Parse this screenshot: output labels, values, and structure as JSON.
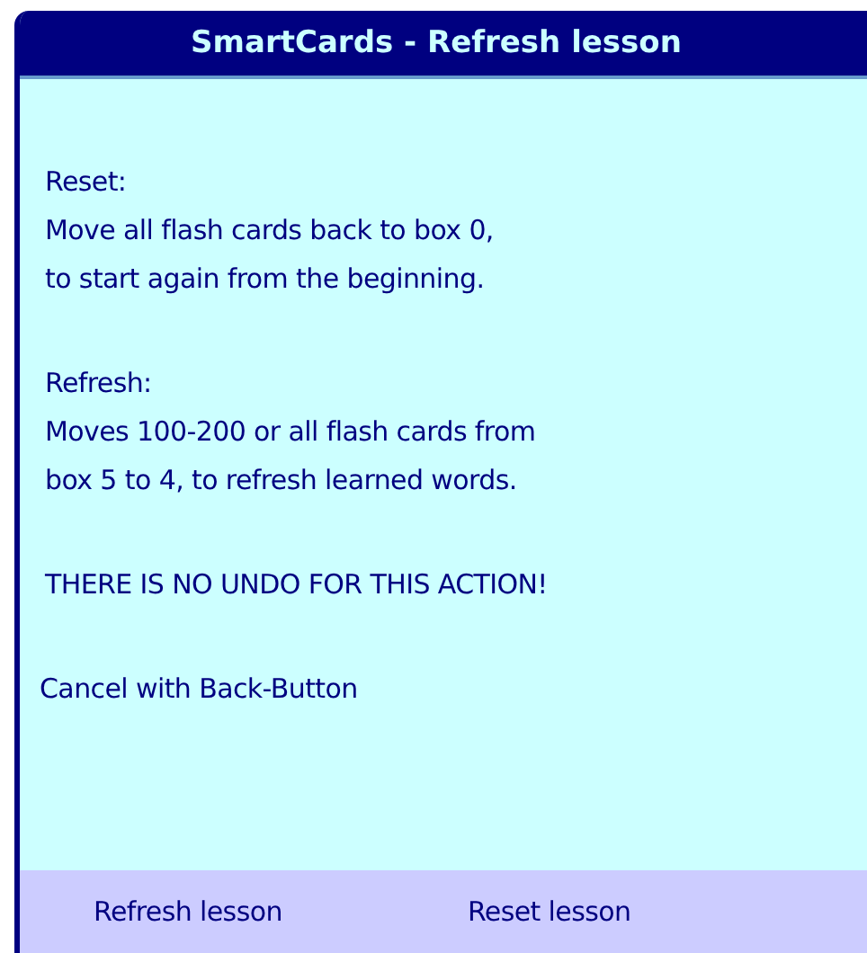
{
  "window": {
    "title": "SmartCards - Refresh lesson"
  },
  "paragraphs": [
    {
      "kind": "info",
      "lines": [
        "Reset:",
        "Move all flash cards back to box 0,",
        "to start again from the beginning."
      ]
    },
    {
      "kind": "info",
      "lines": [
        "Refresh:",
        "Moves 100-200 or all flash cards from",
        "box 5 to 4, to refresh learned words."
      ]
    },
    {
      "kind": "warning",
      "lines": [
        "THERE IS NO UNDO FOR THIS ACTION!"
      ]
    },
    {
      "kind": "hint",
      "lines": [
        "Cancel with Back-Button"
      ]
    }
  ],
  "buttons": [
    "Refresh lesson",
    "Reset lesson"
  ]
}
